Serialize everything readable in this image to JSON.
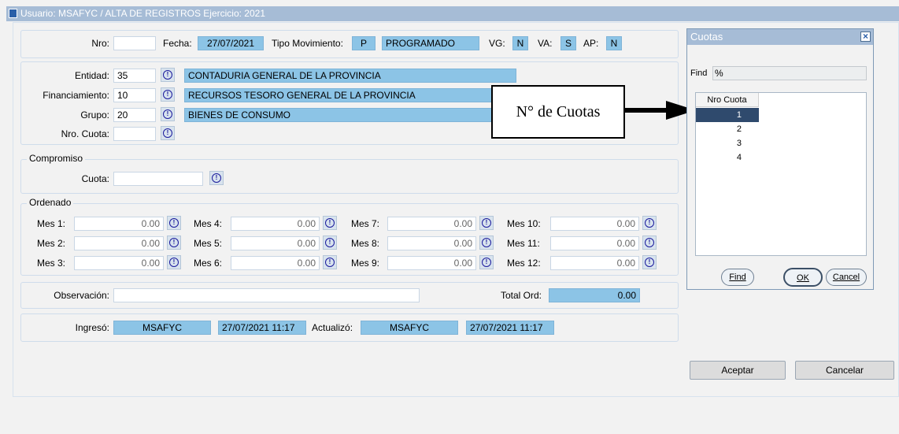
{
  "titlebar": {
    "text": "Usuario: MSAFYC  /  ALTA DE REGISTROS  Ejercicio: 2021"
  },
  "header": {
    "nro_label": "Nro:",
    "nro_value": "",
    "fecha_label": "Fecha:",
    "fecha_value": "27/07/2021",
    "tipo_label": "Tipo Movimiento:",
    "tipo_code": "P",
    "tipo_desc": "PROGRAMADO",
    "vg_label": "VG:",
    "vg_value": "N",
    "va_label": "VA:",
    "va_value": "S",
    "ap_label": "AP:",
    "ap_value": "N"
  },
  "entidad": {
    "entidad_label": "Entidad:",
    "entidad_code": "35",
    "entidad_desc": "CONTADURIA GENERAL DE LA PROVINCIA",
    "fin_label": "Financiamiento:",
    "fin_code": "10",
    "fin_desc": "RECURSOS TESORO GENERAL DE LA PROVINCIA",
    "grupo_label": "Grupo:",
    "grupo_code": "20",
    "grupo_desc": "BIENES DE CONSUMO",
    "cuota_label": "Nro. Cuota:",
    "cuota_value": ""
  },
  "compromiso": {
    "title": "Compromiso",
    "cuota_label": "Cuota:",
    "cuota_value": ""
  },
  "ordenado": {
    "title": "Ordenado",
    "months": [
      {
        "label": "Mes 1:",
        "value": "0.00"
      },
      {
        "label": "Mes 2:",
        "value": "0.00"
      },
      {
        "label": "Mes 3:",
        "value": "0.00"
      },
      {
        "label": "Mes 4:",
        "value": "0.00"
      },
      {
        "label": "Mes 5:",
        "value": "0.00"
      },
      {
        "label": "Mes 6:",
        "value": "0.00"
      },
      {
        "label": "Mes 7:",
        "value": "0.00"
      },
      {
        "label": "Mes 8:",
        "value": "0.00"
      },
      {
        "label": "Mes 9:",
        "value": "0.00"
      },
      {
        "label": "Mes 10:",
        "value": "0.00"
      },
      {
        "label": "Mes 11:",
        "value": "0.00"
      },
      {
        "label": "Mes 12:",
        "value": "0.00"
      }
    ]
  },
  "observacion": {
    "label": "Observación:",
    "value": "",
    "total_label": "Total Ord:",
    "total_value": "0.00"
  },
  "audit": {
    "ingreso_label": "Ingresó:",
    "ingreso_user": "MSAFYC",
    "ingreso_date": "27/07/2021 11:17",
    "actualizo_label": "Actualizó:",
    "actualizo_user": "MSAFYC",
    "actualizo_date": "27/07/2021 11:17"
  },
  "actions": {
    "aceptar": "Aceptar",
    "cancelar": "Cancelar"
  },
  "annotation": {
    "text": "N° de Cuotas"
  },
  "lov_dialog": {
    "title": "Cuotas",
    "close": "×",
    "find_label": "Find",
    "find_value": "%",
    "column_header": "Nro Cuota",
    "rows": [
      "1",
      "2",
      "3",
      "4"
    ],
    "selected_row": 0,
    "find_button": "Find",
    "ok_button": "OK",
    "cancel_button": "Cancel"
  },
  "colors": {
    "field_blue": "#8cc4e6",
    "title_blue": "#a6bcd6",
    "selected": "#2f4a6d"
  }
}
